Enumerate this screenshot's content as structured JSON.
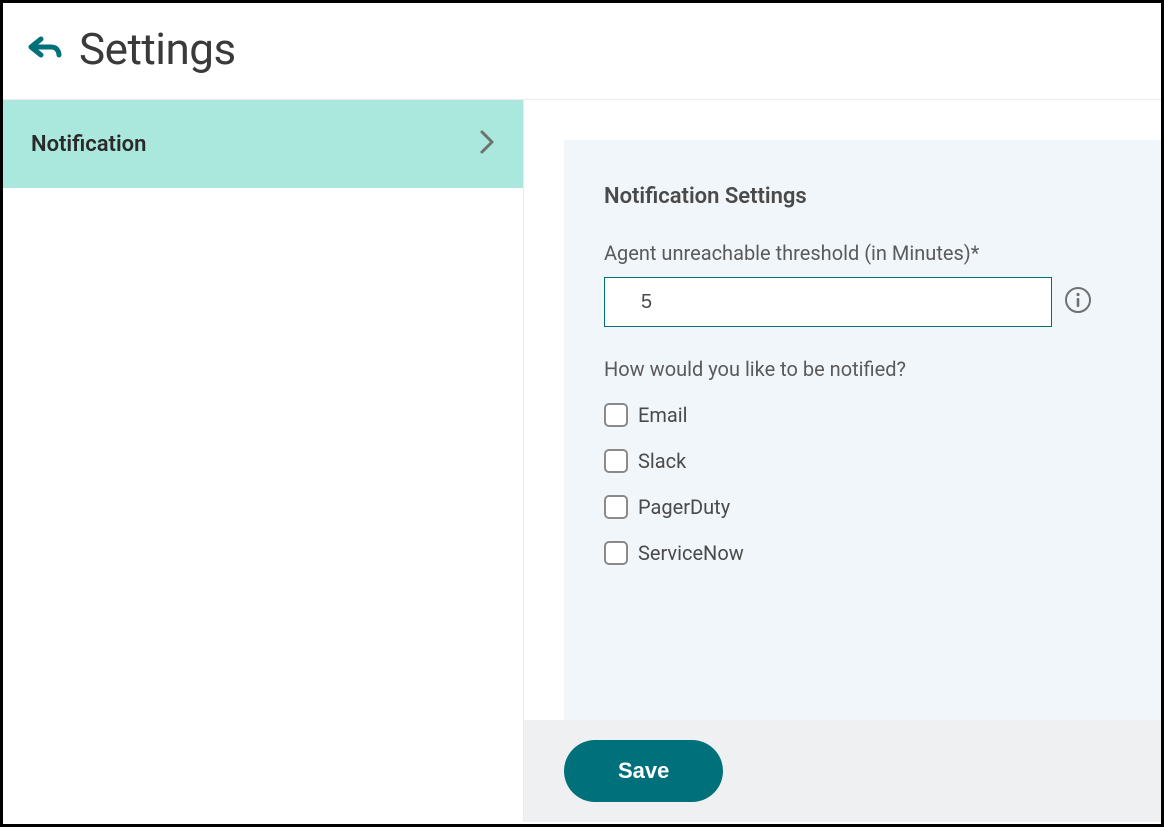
{
  "header": {
    "title": "Settings"
  },
  "sidebar": {
    "items": [
      {
        "label": "Notification"
      }
    ]
  },
  "panel": {
    "title": "Notification Settings",
    "threshold_label": "Agent unreachable threshold (in Minutes)*",
    "threshold_value": "5",
    "notify_question": "How would you like to be notified?",
    "options": [
      {
        "label": "Email",
        "checked": false
      },
      {
        "label": "Slack",
        "checked": false
      },
      {
        "label": "PagerDuty",
        "checked": false
      },
      {
        "label": "ServiceNow",
        "checked": false
      }
    ]
  },
  "footer": {
    "save_label": "Save"
  }
}
